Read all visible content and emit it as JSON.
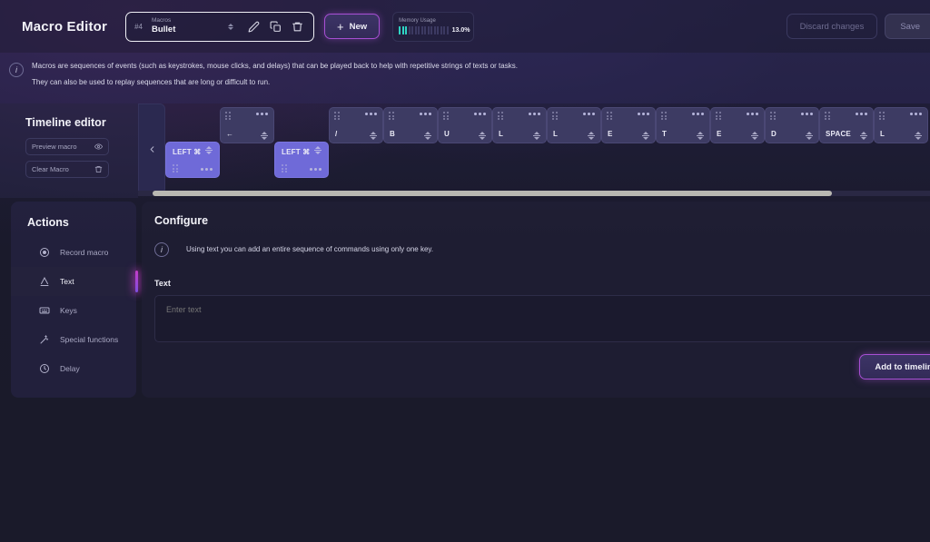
{
  "header": {
    "app_title": "Macro Editor",
    "macro_selector": {
      "index": "#4",
      "caption": "Macros",
      "value": "Bullet",
      "icons": [
        "edit-pencil-icon",
        "duplicate-icon",
        "delete-trash-icon"
      ]
    },
    "new_button": {
      "label": "New",
      "plus": "+"
    },
    "memory": {
      "caption": "Memory Usage",
      "percent_label": "13.0%",
      "percent_value": 13.0,
      "bars_total": 16,
      "bars_filled": 3,
      "fill_color": "#2fd4c4"
    },
    "discard_label": "Discard changes",
    "save_label": "Save"
  },
  "banner": {
    "icon": "info-icon",
    "line1": "Macros are sequences of events (such as keystrokes, mouse clicks, and delays) that can be played back to help with repetitive strings of texts or tasks.",
    "line2": "They can also be used to replay sequences that are long or difficult to run."
  },
  "timeline": {
    "title": "Timeline editor",
    "preview_label": "Preview macro",
    "clear_label": "Clear Macro",
    "collapse_icon": "chevron-left-icon",
    "top_row": [
      {
        "label": "",
        "kind": "gap"
      },
      {
        "label": "←",
        "kind": "key"
      },
      {
        "label": "",
        "kind": "gap"
      },
      {
        "label": "/",
        "kind": "key"
      },
      {
        "label": "B",
        "kind": "key"
      },
      {
        "label": "U",
        "kind": "key"
      },
      {
        "label": "L",
        "kind": "key"
      },
      {
        "label": "L",
        "kind": "key"
      },
      {
        "label": "E",
        "kind": "key"
      },
      {
        "label": "T",
        "kind": "key"
      },
      {
        "label": "E",
        "kind": "key"
      },
      {
        "label": "D",
        "kind": "key"
      },
      {
        "label": "SPACE",
        "kind": "key"
      },
      {
        "label": "L",
        "kind": "key"
      }
    ],
    "bottom_row": [
      {
        "label": "LEFT ⌘",
        "kind": "mod"
      },
      {
        "label": "",
        "kind": "gap"
      },
      {
        "label": "LEFT ⌘",
        "kind": "mod"
      }
    ]
  },
  "actions": {
    "title": "Actions",
    "items": [
      {
        "label": "Record macro",
        "icon": "record-dot-icon",
        "active": false
      },
      {
        "label": "Text",
        "icon": "text-a-icon",
        "active": true
      },
      {
        "label": "Keys",
        "icon": "keyboard-icon",
        "active": false
      },
      {
        "label": "Special functions",
        "icon": "magic-wand-icon",
        "active": false
      },
      {
        "label": "Delay",
        "icon": "clock-icon",
        "active": false
      }
    ]
  },
  "configure": {
    "title": "Configure",
    "info_icon": "info-icon",
    "info_text": "Using text you can add an entire sequence of commands using only one key.",
    "field_label": "Text",
    "input_value": "",
    "input_placeholder": "Enter text",
    "add_label": "Add to timeline"
  },
  "colors": {
    "accent_purple": "#a74fd3",
    "accent_pink": "#c43cc8",
    "mod_card": "#6f6ad8",
    "teal": "#2fd4c4"
  }
}
